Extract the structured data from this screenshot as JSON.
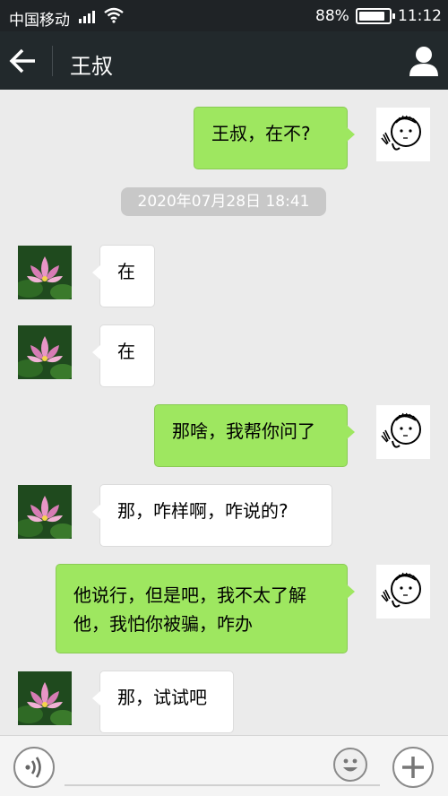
{
  "status_bar": {
    "carrier": "中国移动",
    "battery_percent": "88%",
    "battery_level": 0.88,
    "time": "11:12"
  },
  "header": {
    "title": "王叔",
    "back_icon": "arrow-left-icon",
    "profile_icon": "person-icon"
  },
  "messages": [
    {
      "sender": "me",
      "text": "王叔，在不?"
    },
    {
      "sender": "other",
      "text": "在"
    },
    {
      "sender": "other",
      "text": "在"
    },
    {
      "sender": "me",
      "text": "那啥，我帮你问了"
    },
    {
      "sender": "other",
      "text": "那，咋样啊，咋说的?"
    },
    {
      "sender": "me",
      "lines": [
        "他说行，但是吧，我不太了解",
        "他，我怕你被骗，咋办"
      ]
    },
    {
      "sender": "other",
      "text": "那，试试吧"
    }
  ],
  "timestamp": "2020年07月28日 18:41",
  "input_bar": {
    "voice_icon": "voice-icon",
    "emoji_icon": "emoji-icon",
    "plus_icon": "plus-icon",
    "text_value": ""
  },
  "colors": {
    "header_bg": "#22292c",
    "my_bubble": "#9ee760",
    "other_bubble": "#ffffff",
    "background": "#ebebeb"
  }
}
